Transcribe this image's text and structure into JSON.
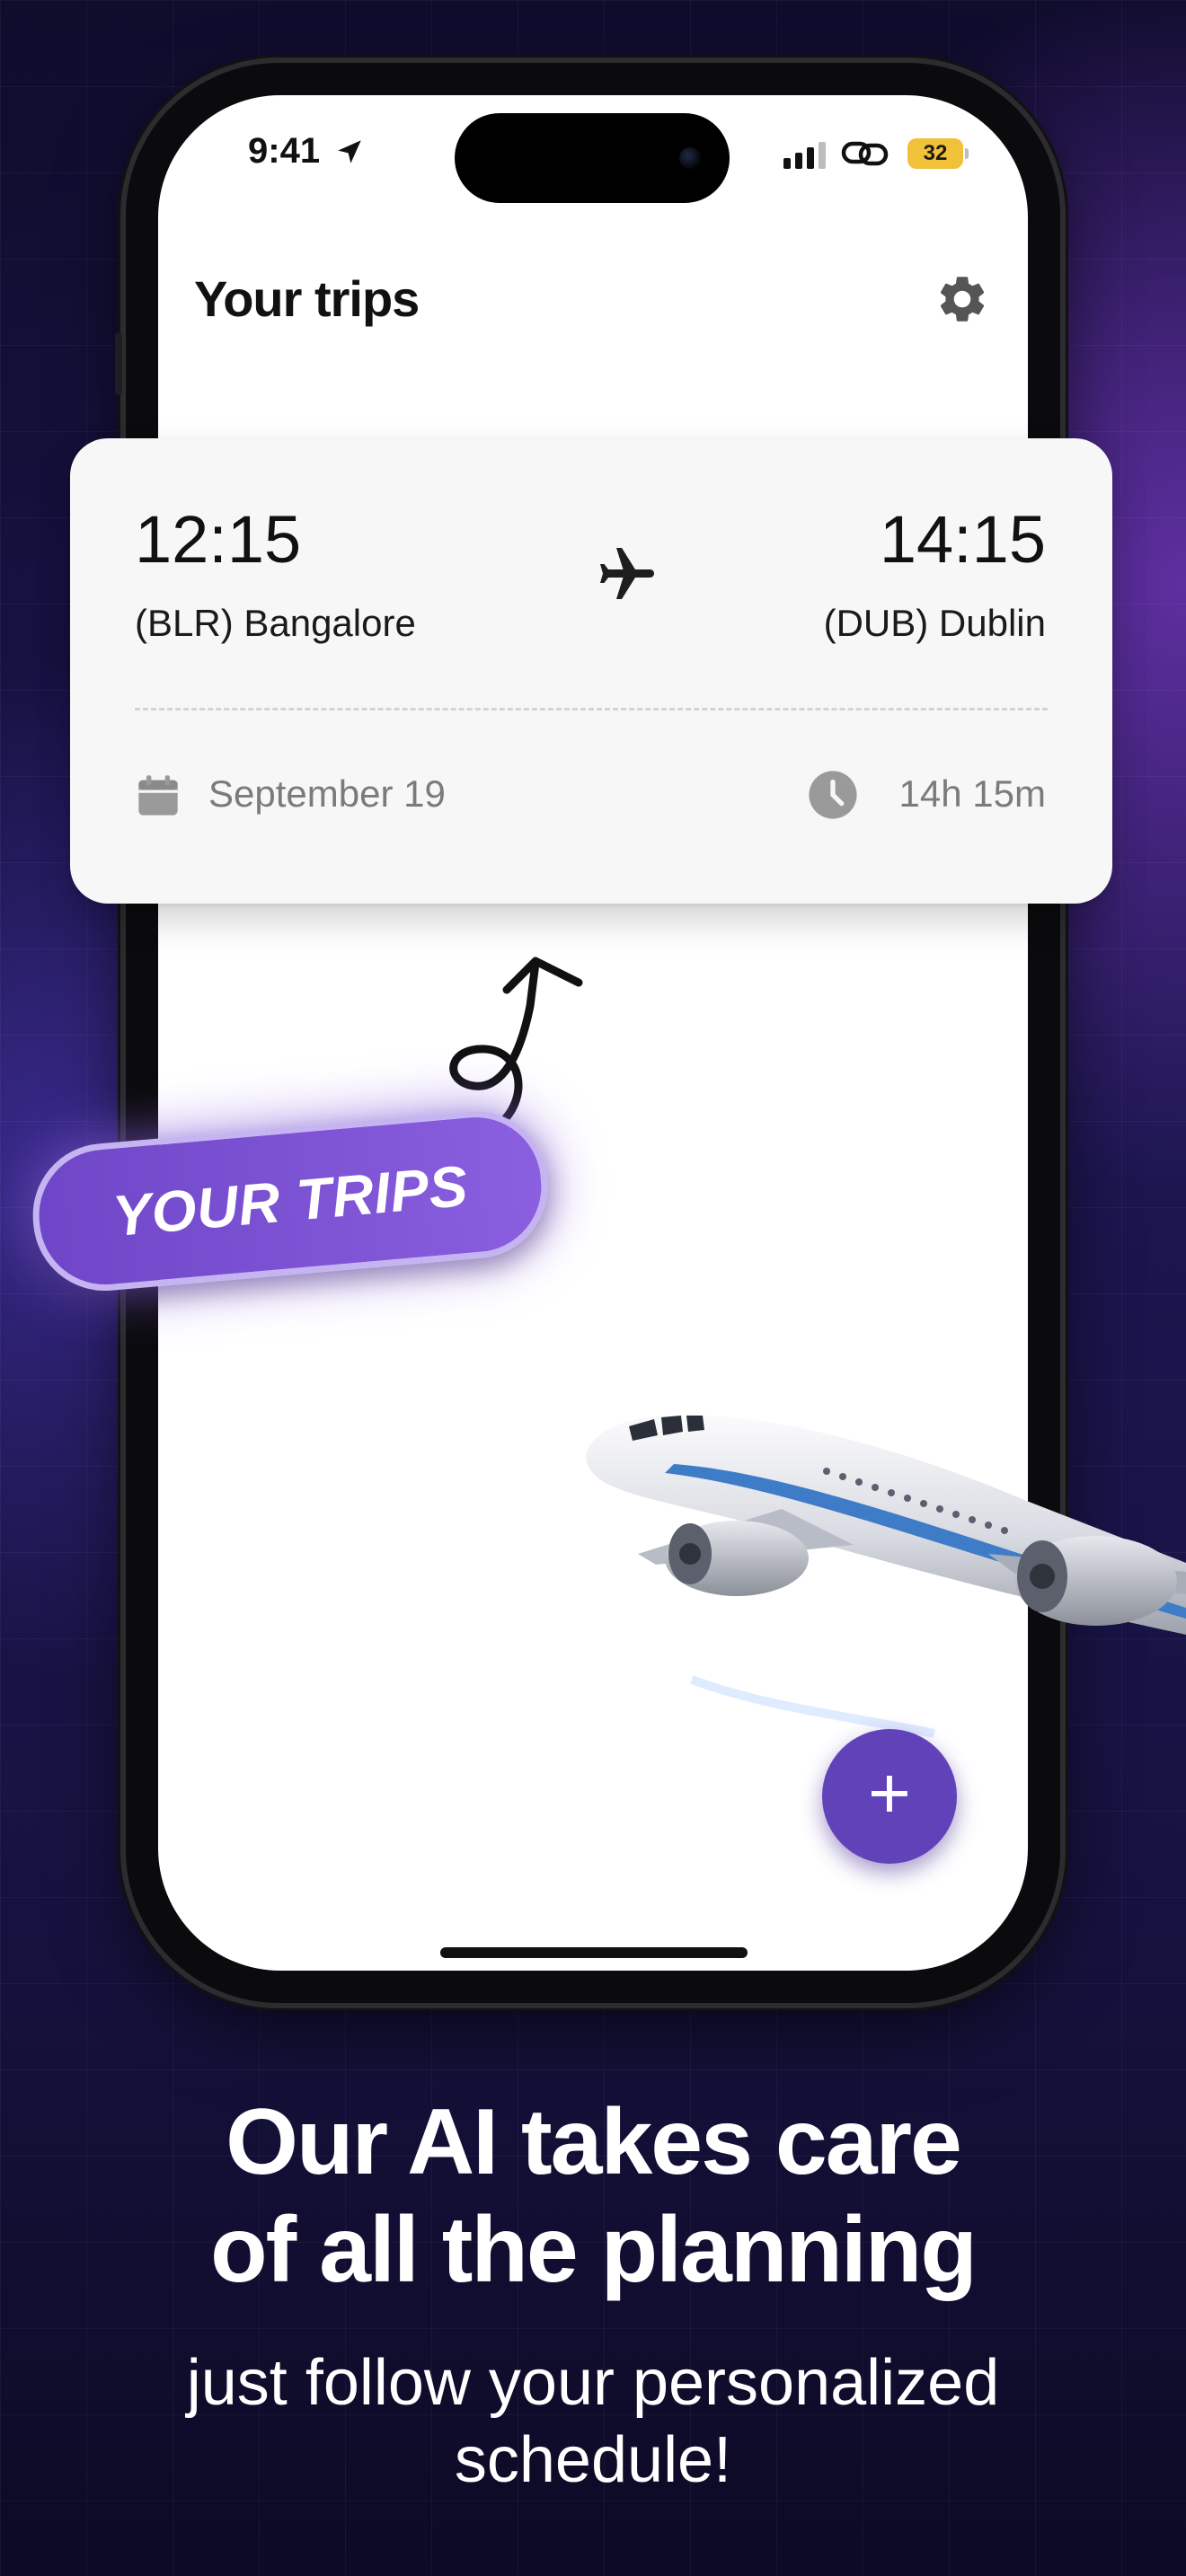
{
  "status_bar": {
    "time": "9:41",
    "battery": "32"
  },
  "header": {
    "title": "Your trips"
  },
  "trip_card": {
    "departure_time": "12:15",
    "departure_city": "(BLR) Bangalore",
    "arrival_time": "14:15",
    "arrival_city": "(DUB) Dublin",
    "date": "September 19",
    "duration": "14h 15m"
  },
  "callout": {
    "label": "YOUR TRIPS"
  },
  "fab": {
    "label": "+"
  },
  "promo": {
    "headline_line1": "Our AI takes care",
    "headline_line2": "of all the planning",
    "subline_line1": "just follow your personalized",
    "subline_line2": "schedule!"
  },
  "colors": {
    "accent": "#6142b8",
    "pill": "#7b52d6",
    "battery": "#f2c13a"
  },
  "icons": [
    "location-arrow-icon",
    "signal-icon",
    "link-icon",
    "battery-icon",
    "gear-icon",
    "airplane-icon",
    "calendar-icon",
    "clock-icon",
    "plus-icon"
  ]
}
